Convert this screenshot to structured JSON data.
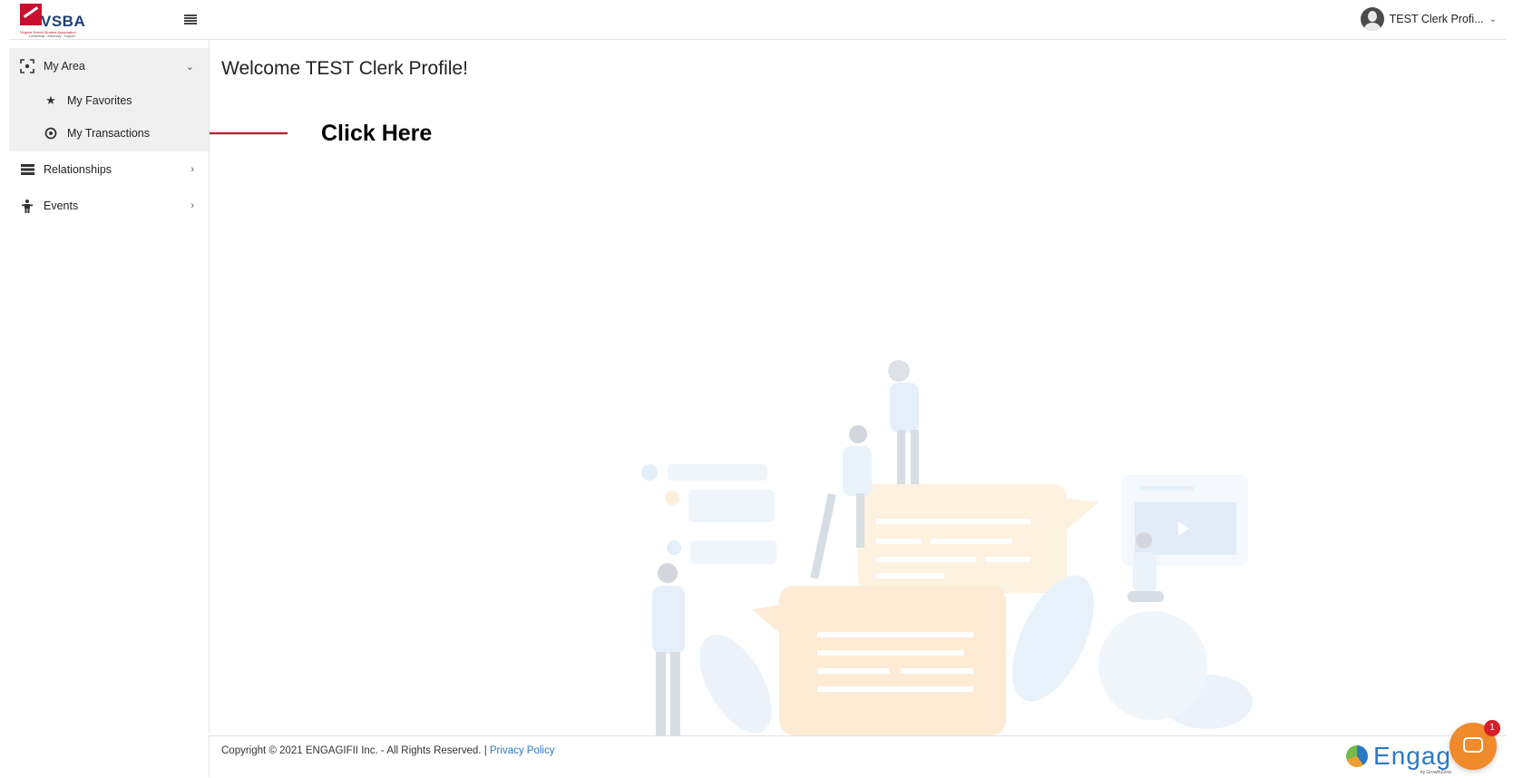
{
  "header": {
    "logo": {
      "brand": "VSBA",
      "tagline": "Virginia School Boards Association",
      "subtagline": "Leadership · Advocacy · Support"
    },
    "menu_icon": "hamburger-icon",
    "profile": {
      "name": "TEST Clerk Profi...",
      "icon": "user-avatar-icon",
      "caret": "⌄"
    }
  },
  "sidebar": {
    "section": {
      "label": "My Area",
      "icon": "focus-icon",
      "chevron": "⌄"
    },
    "subitems": [
      {
        "label": "My Favorites",
        "icon": "star-icon"
      },
      {
        "label": "My Transactions",
        "icon": "transactions-icon"
      }
    ],
    "items": [
      {
        "label": "Relationships",
        "icon": "list-icon",
        "chevron": "›"
      },
      {
        "label": "Events",
        "icon": "person-icon",
        "chevron": "›"
      }
    ]
  },
  "main": {
    "welcome": "Welcome TEST Clerk Profile!",
    "annotation": "Click Here"
  },
  "footer": {
    "copyright": "Copyright © 2021 ENGAGIFII Inc. - All Rights Reserved. | ",
    "privacy_link": "Privacy Policy",
    "engage_logo": "Engag",
    "engage_sub": "by GrowthZone",
    "chat_badge": "1"
  },
  "colors": {
    "accent": "#2b78c2",
    "annotation_arrow": "#c8102e",
    "chat": "#f08a2a",
    "badge": "#d91e2a"
  }
}
